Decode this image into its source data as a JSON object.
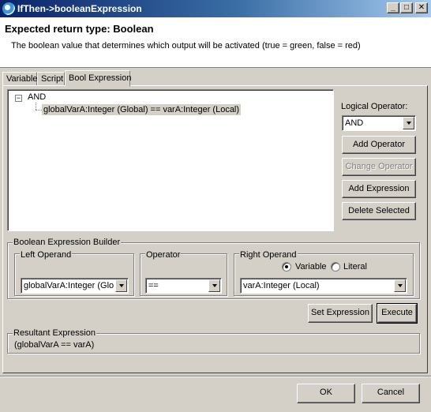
{
  "window": {
    "title": "IfThen->booleanExpression",
    "controls": {
      "minimize": "_",
      "maximize": "□",
      "close": "✕"
    }
  },
  "header": {
    "title": "Expected return type: Boolean",
    "description": "The boolean value that determines which output will be activated (true = green, false = red)"
  },
  "tabs": [
    {
      "label": "Variable"
    },
    {
      "label": "Script"
    },
    {
      "label": "Bool Expression"
    }
  ],
  "tree": {
    "toggle": "−",
    "root": "AND",
    "children": [
      "globalVarA:Integer (Global) == varA:Integer (Local)"
    ]
  },
  "side": {
    "logical_operator_label": "Logical Operator:",
    "logical_operator_value": "AND",
    "add_operator": "Add Operator",
    "change_operator": "Change Operator",
    "add_expression": "Add Expression",
    "delete_selected": "Delete Selected"
  },
  "builder": {
    "title": "Boolean Expression Builder",
    "left_operand": {
      "label": "Left Operand",
      "value": "globalVarA:Integer (Global)"
    },
    "operator": {
      "label": "Operator",
      "value": "=="
    },
    "right_operand": {
      "label": "Right Operand",
      "variable_label": "Variable",
      "literal_label": "Literal",
      "selected": "Variable",
      "value": "varA:Integer (Local)"
    }
  },
  "actions": {
    "set_expression": "Set Expression",
    "execute": "Execute"
  },
  "result": {
    "label": "Resultant Expression",
    "value": "(globalVarA == varA)"
  },
  "footer": {
    "ok": "OK",
    "cancel": "Cancel"
  }
}
